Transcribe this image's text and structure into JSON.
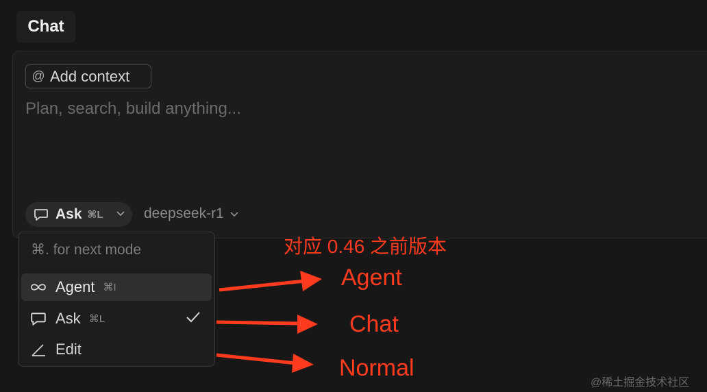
{
  "tab": {
    "title": "Chat"
  },
  "composer": {
    "add_context": "Add context",
    "placeholder": "Plan, search, build anything...",
    "mode_label": "Ask",
    "mode_shortcut": "⌘L",
    "model": "deepseek-r1"
  },
  "mode_menu": {
    "hint": "⌘. for next mode",
    "items": [
      {
        "label": "Agent",
        "shortcut": "⌘I",
        "icon": "infinity-icon"
      },
      {
        "label": "Ask",
        "shortcut": "⌘L",
        "icon": "chat-bubble-icon"
      },
      {
        "label": "Edit",
        "shortcut": "",
        "icon": "pencil-icon"
      }
    ]
  },
  "annotation": {
    "note": "对应 0.46 之前版本",
    "labels": [
      "Agent",
      "Chat",
      "Normal"
    ],
    "color": "#ff3b1f"
  },
  "watermark": "@稀土掘金技术社区"
}
